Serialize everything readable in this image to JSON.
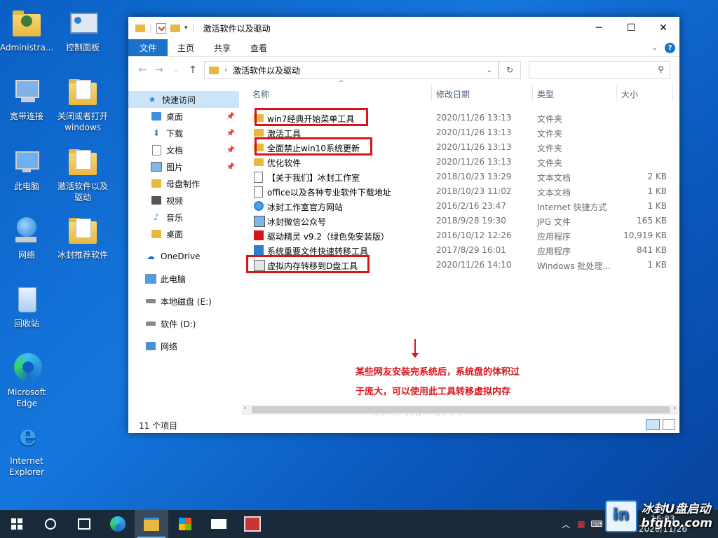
{
  "desktop": {
    "icons": [
      {
        "label": "Administra..."
      },
      {
        "label": "控制面板"
      },
      {
        "label": "宽带连接"
      },
      {
        "label": "关闭或者打开windows D..."
      },
      {
        "label": "此电脑"
      },
      {
        "label": "激活软件以及驱动"
      },
      {
        "label": "网络"
      },
      {
        "label": "冰封推荐软件"
      },
      {
        "label": "回收站"
      },
      {
        "label": "Microsoft Edge"
      },
      {
        "label": "Internet Explorer"
      }
    ]
  },
  "window": {
    "title": "激活软件以及驱动",
    "ribbon_tabs": [
      "文件",
      "主页",
      "共享",
      "查看"
    ],
    "address_path": "激活软件以及驱动",
    "search_placeholder": "",
    "nav_items": [
      {
        "label": "快速访问"
      },
      {
        "label": "桌面"
      },
      {
        "label": "下载"
      },
      {
        "label": "文档"
      },
      {
        "label": "图片"
      },
      {
        "label": "母盘制作"
      },
      {
        "label": "视频"
      },
      {
        "label": "音乐"
      },
      {
        "label": "桌面"
      },
      {
        "label": "OneDrive"
      },
      {
        "label": "此电脑"
      },
      {
        "label": "本地磁盘 (E:)"
      },
      {
        "label": "软件 (D:)"
      },
      {
        "label": "网络"
      }
    ],
    "columns": {
      "name": "名称",
      "date": "修改日期",
      "type": "类型",
      "size": "大小"
    },
    "files": [
      {
        "name": "win7经典开始菜单工具",
        "date": "2020/11/26 13:13",
        "type": "文件夹",
        "size": "",
        "icon": "folder",
        "boxed": true
      },
      {
        "name": "激活工具",
        "date": "2020/11/26 13:13",
        "type": "文件夹",
        "size": "",
        "icon": "folder",
        "boxed": false
      },
      {
        "name": "全面禁止win10系统更新",
        "date": "2020/11/26 13:13",
        "type": "文件夹",
        "size": "",
        "icon": "folder",
        "boxed": true
      },
      {
        "name": "优化软件",
        "date": "2020/11/26 13:13",
        "type": "文件夹",
        "size": "",
        "icon": "folder",
        "boxed": false
      },
      {
        "name": "【关于我们】冰封工作室",
        "date": "2018/10/23 13:29",
        "type": "文本文档",
        "size": "2 KB",
        "icon": "text",
        "boxed": false
      },
      {
        "name": "office以及各种专业软件下载地址",
        "date": "2018/10/23 11:02",
        "type": "文本文档",
        "size": "1 KB",
        "icon": "text",
        "boxed": false
      },
      {
        "name": "冰封工作室官方网站",
        "date": "2016/2/16 23:47",
        "type": "Internet 快捷方式",
        "size": "1 KB",
        "icon": "web",
        "boxed": false
      },
      {
        "name": "冰封微信公众号",
        "date": "2018/9/28 19:30",
        "type": "JPG 文件",
        "size": "165 KB",
        "icon": "jpg",
        "boxed": false
      },
      {
        "name": "驱动精灵 v9.2（绿色免安装版）",
        "date": "2016/10/12 12:26",
        "type": "应用程序",
        "size": "10,919 KB",
        "icon": "app-red",
        "boxed": false
      },
      {
        "name": "系统重要文件快速转移工具",
        "date": "2017/8/29 16:01",
        "type": "应用程序",
        "size": "841 KB",
        "icon": "app-blue",
        "boxed": false
      },
      {
        "name": "虚拟内存转移到D盘工具",
        "date": "2020/11/26 14:10",
        "type": "Windows 批处理...",
        "size": "1 KB",
        "icon": "bat",
        "boxed": true
      }
    ],
    "annotation_lines": [
      "某些网友安装完系统后，系统盘的体积过",
      "于庞大，可以使用此工具转移虚拟内存",
      "到D盘，双击后，重启即可。"
    ],
    "status_text": "11 个项目"
  },
  "taskbar": {
    "clock_time": "16:03",
    "clock_date": "2020/11/26",
    "lang": "英"
  },
  "watermark": {
    "line1": "冰封U盘启动",
    "line2": "bfgho.com"
  },
  "colors": {
    "accent": "#1a73c8",
    "highlight": "#d9141b",
    "folder": "#e9b93f"
  }
}
